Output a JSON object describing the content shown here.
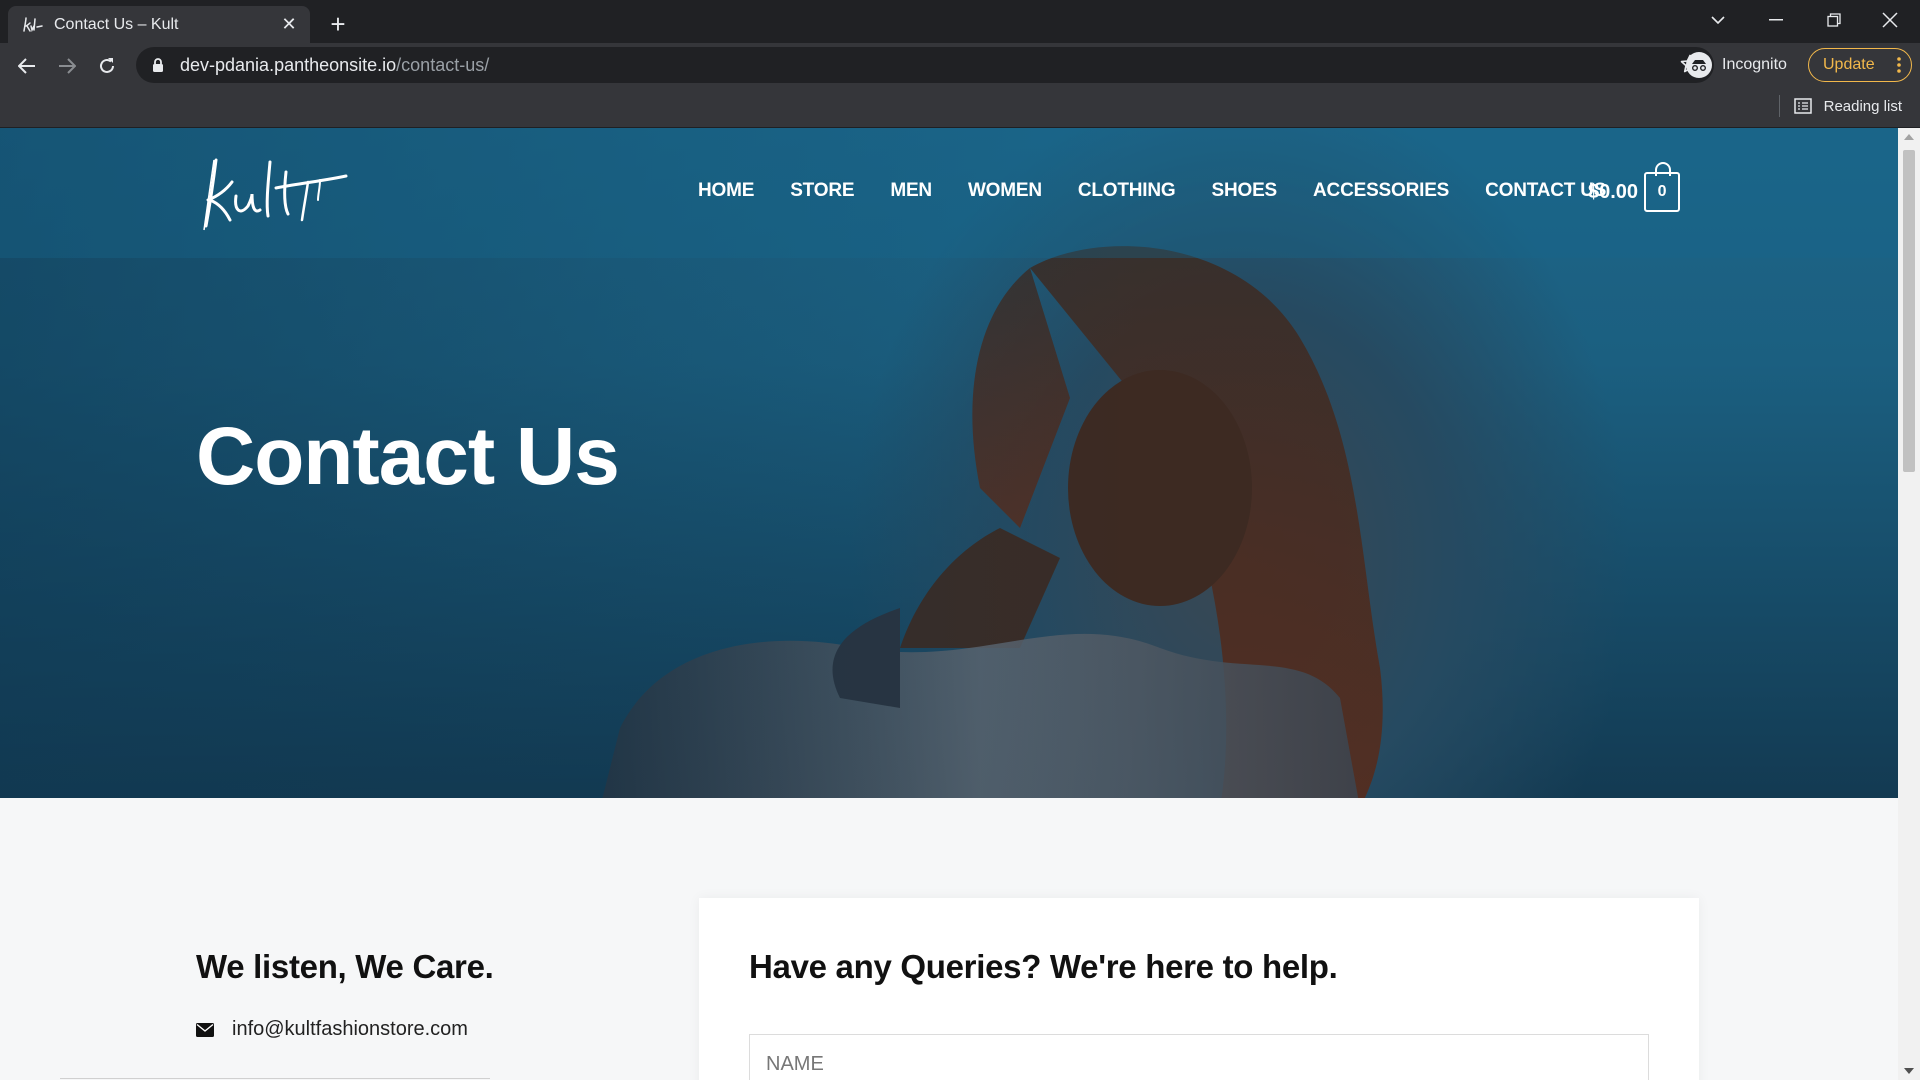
{
  "browser": {
    "tab_title": "Contact Us – Kult",
    "url_host": "dev-pdania.pantheonsite.io",
    "url_path": "/contact-us/",
    "profile_label": "Incognito",
    "update_label": "Update",
    "reading_list_label": "Reading list"
  },
  "site": {
    "nav": [
      "HOME",
      "STORE",
      "MEN",
      "WOMEN",
      "CLOTHING",
      "SHOES",
      "ACCESSORIES",
      "CONTACT US"
    ],
    "cart_total": "$0.00",
    "cart_count": "0"
  },
  "hero": {
    "title": "Contact Us"
  },
  "contact": {
    "heading": "We listen, We Care.",
    "email": "info@kultfashionstore.com"
  },
  "form": {
    "heading": "Have any Queries? We're here to help.",
    "name_placeholder": "NAME"
  },
  "colors": {
    "hero_blue": "#1b5f80",
    "update_accent": "#f2b84b",
    "chrome_dark": "#202124"
  }
}
